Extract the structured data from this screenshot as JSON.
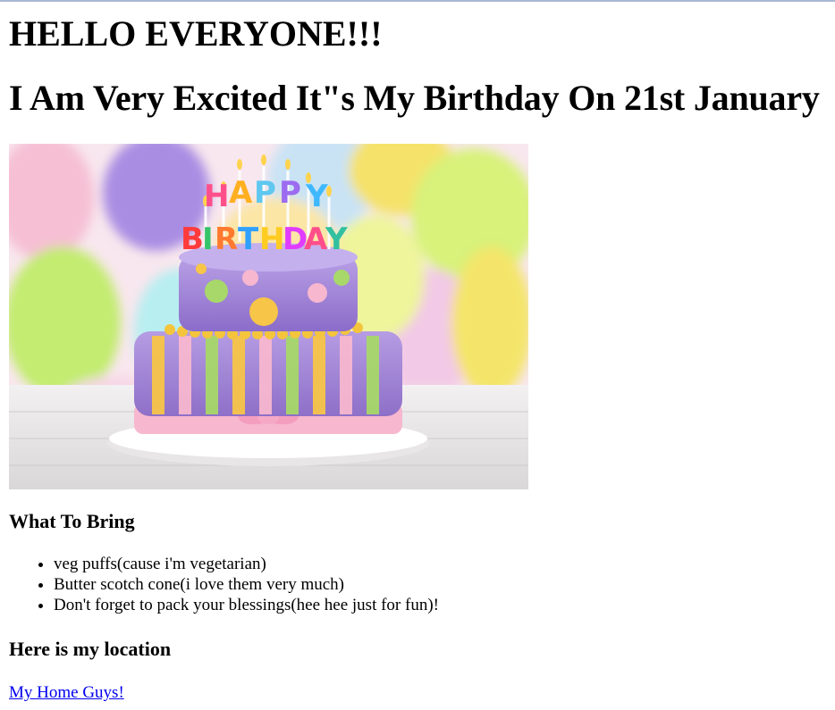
{
  "header": {
    "greeting": "HELLO EVERYONE!!!",
    "subtitle": "I Am Very Excited It\"s My Birthday On 21st January"
  },
  "hero_image": {
    "cake_letters": [
      "H",
      "A",
      "P",
      "P",
      "Y",
      "B",
      "I",
      "R",
      "T",
      "H",
      "D",
      "A",
      "Y"
    ],
    "letter_colors": [
      "#ff4f8b",
      "#ffb020",
      "#5fc7f0",
      "#9c6cf0",
      "#3fb8ff",
      "#ff3b3b",
      "#36c46a",
      "#ff7a2f",
      "#2fa0ff",
      "#ffcc22",
      "#e13cff",
      "#ff4f8b",
      "#32c0a0"
    ]
  },
  "sections": {
    "bring_heading": "What To Bring",
    "bring_items": [
      "veg puffs(cause i'm vegetarian)",
      "Butter scotch cone(i love them very much)",
      "Don't forget to pack your blessings(hee hee just for fun)!"
    ],
    "location_heading": "Here is my location",
    "location_link": "My Home Guys!"
  },
  "colors": {
    "link": "#0000ee",
    "top_border": "#a9b8d6"
  }
}
